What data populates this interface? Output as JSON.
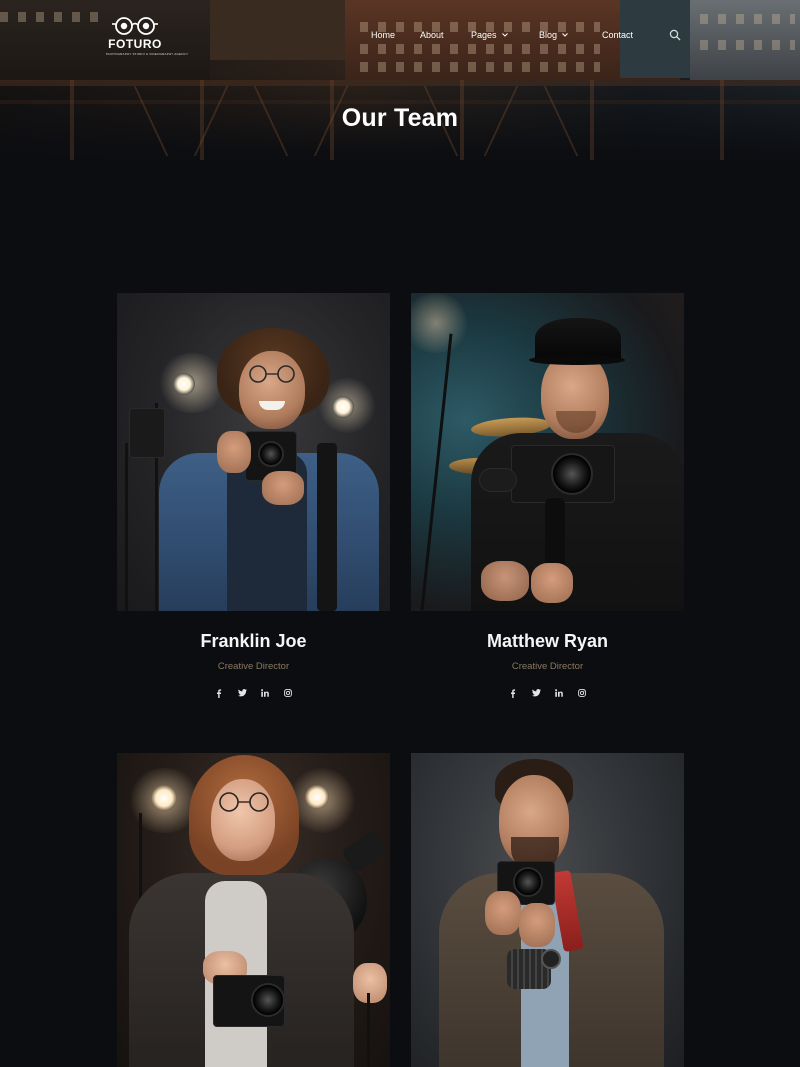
{
  "brand": {
    "name": "FOTURO",
    "tagline": "PHOTOGRAPHY STUDIO & VIDEOGRAPHY AGENCY"
  },
  "nav": {
    "items": [
      {
        "label": "Home",
        "dropdown": false
      },
      {
        "label": "About",
        "dropdown": false
      },
      {
        "label": "Pages",
        "dropdown": true
      },
      {
        "label": "Blog",
        "dropdown": true
      },
      {
        "label": "Contact",
        "dropdown": false
      }
    ],
    "search_icon": "search-icon"
  },
  "hero": {
    "title": "Our Team"
  },
  "team": [
    {
      "name": "Franklin Joe",
      "role": "Creative Director",
      "socials": [
        "facebook-icon",
        "twitter-icon",
        "linkedin-icon",
        "instagram-icon"
      ]
    },
    {
      "name": "Matthew Ryan",
      "role": "Creative Director",
      "socials": [
        "facebook-icon",
        "twitter-icon",
        "linkedin-icon",
        "instagram-icon"
      ]
    },
    {
      "name": "",
      "role": "",
      "socials": []
    },
    {
      "name": "",
      "role": "",
      "socials": []
    }
  ],
  "colors": {
    "background": "#0b0d11",
    "role_text": "#8a7a62",
    "heading": "#ffffff"
  }
}
